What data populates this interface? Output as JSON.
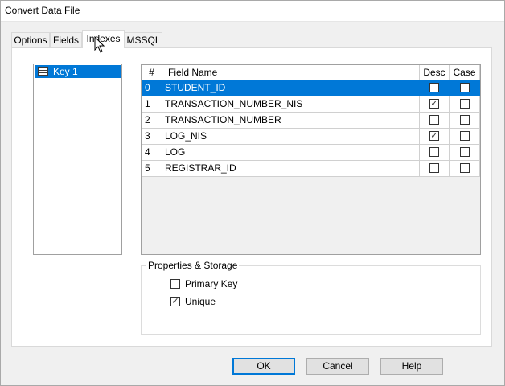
{
  "window": {
    "title": "Convert Data File"
  },
  "tabs": [
    {
      "label": "Options"
    },
    {
      "label": "Fields"
    },
    {
      "label": "Indexes",
      "active": true
    },
    {
      "label": "MSSQL"
    }
  ],
  "keys": [
    {
      "label": "Key 1",
      "icon": "table-icon",
      "selected": true
    }
  ],
  "grid": {
    "columns": [
      "#",
      "Field Name",
      "Desc",
      "Case"
    ],
    "rows": [
      {
        "num": "0",
        "name": "STUDENT_ID",
        "desc": false,
        "case": false,
        "selected": true
      },
      {
        "num": "1",
        "name": "TRANSACTION_NUMBER_NIS",
        "desc": true,
        "case": false
      },
      {
        "num": "2",
        "name": "TRANSACTION_NUMBER",
        "desc": false,
        "case": false
      },
      {
        "num": "3",
        "name": "LOG_NIS",
        "desc": true,
        "case": false
      },
      {
        "num": "4",
        "name": "LOG",
        "desc": false,
        "case": false
      },
      {
        "num": "5",
        "name": "REGISTRAR_ID",
        "desc": false,
        "case": false
      }
    ]
  },
  "properties": {
    "legend": "Properties & Storage",
    "primary_key": {
      "label": "Primary Key",
      "checked": false
    },
    "unique": {
      "label": "Unique",
      "checked": true
    }
  },
  "buttons": {
    "ok": "OK",
    "cancel": "Cancel",
    "help": "Help"
  },
  "colors": {
    "selection": "#0078d7",
    "default_button_border": "#0078d7"
  }
}
